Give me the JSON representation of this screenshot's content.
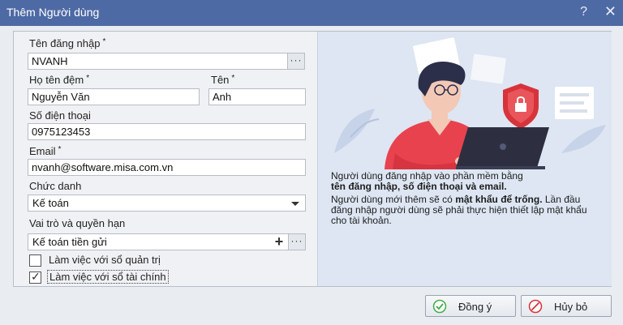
{
  "window": {
    "title": "Thêm Người dùng",
    "help_label": "?",
    "close_label": "✕"
  },
  "form": {
    "username": {
      "label": "Tên đăng nhập",
      "required_mark": "*",
      "value": "NVANH",
      "button_label": "···"
    },
    "middle_name": {
      "label": "Họ tên đệm",
      "required_mark": "*",
      "value": "Nguyễn Văn"
    },
    "first_name": {
      "label": "Tên",
      "required_mark": "*",
      "value": "Anh"
    },
    "phone": {
      "label": "Số điện thoại",
      "value": "0975123453"
    },
    "email": {
      "label": "Email",
      "required_mark": "*",
      "value": "nvanh@software.misa.com.vn"
    },
    "position": {
      "label": "Chức danh",
      "value": "Kế toán"
    },
    "role": {
      "label": "Vai trò và quyền hạn",
      "value": "Kế toán tiền gửi",
      "add_label": "+",
      "more_label": "···"
    },
    "checkboxes": [
      {
        "label": "Làm việc với sổ quản trị",
        "checked": false
      },
      {
        "label": "Làm việc với sổ tài chính",
        "checked": true,
        "check_glyph": "✓"
      }
    ]
  },
  "info": {
    "line1_pre": "Người dùng đăng nhập vào phần mềm bằng",
    "line1_bold": "tên đăng nhập, số điện thoại và email.",
    "line2_pre": "Người dùng mới thêm sẽ có",
    "line2_bold": "mật khẩu để trống.",
    "line2_post": "Lần đầu đăng nhập người dùng sẽ phải thực hiện thiết lập mật khẩu cho tài khoản."
  },
  "buttons": {
    "ok": "Đồng ý",
    "cancel": "Hủy bỏ"
  },
  "colors": {
    "titlebar": "#4e6aa5",
    "accent_green": "#3fae49",
    "accent_red": "#d8333b"
  }
}
